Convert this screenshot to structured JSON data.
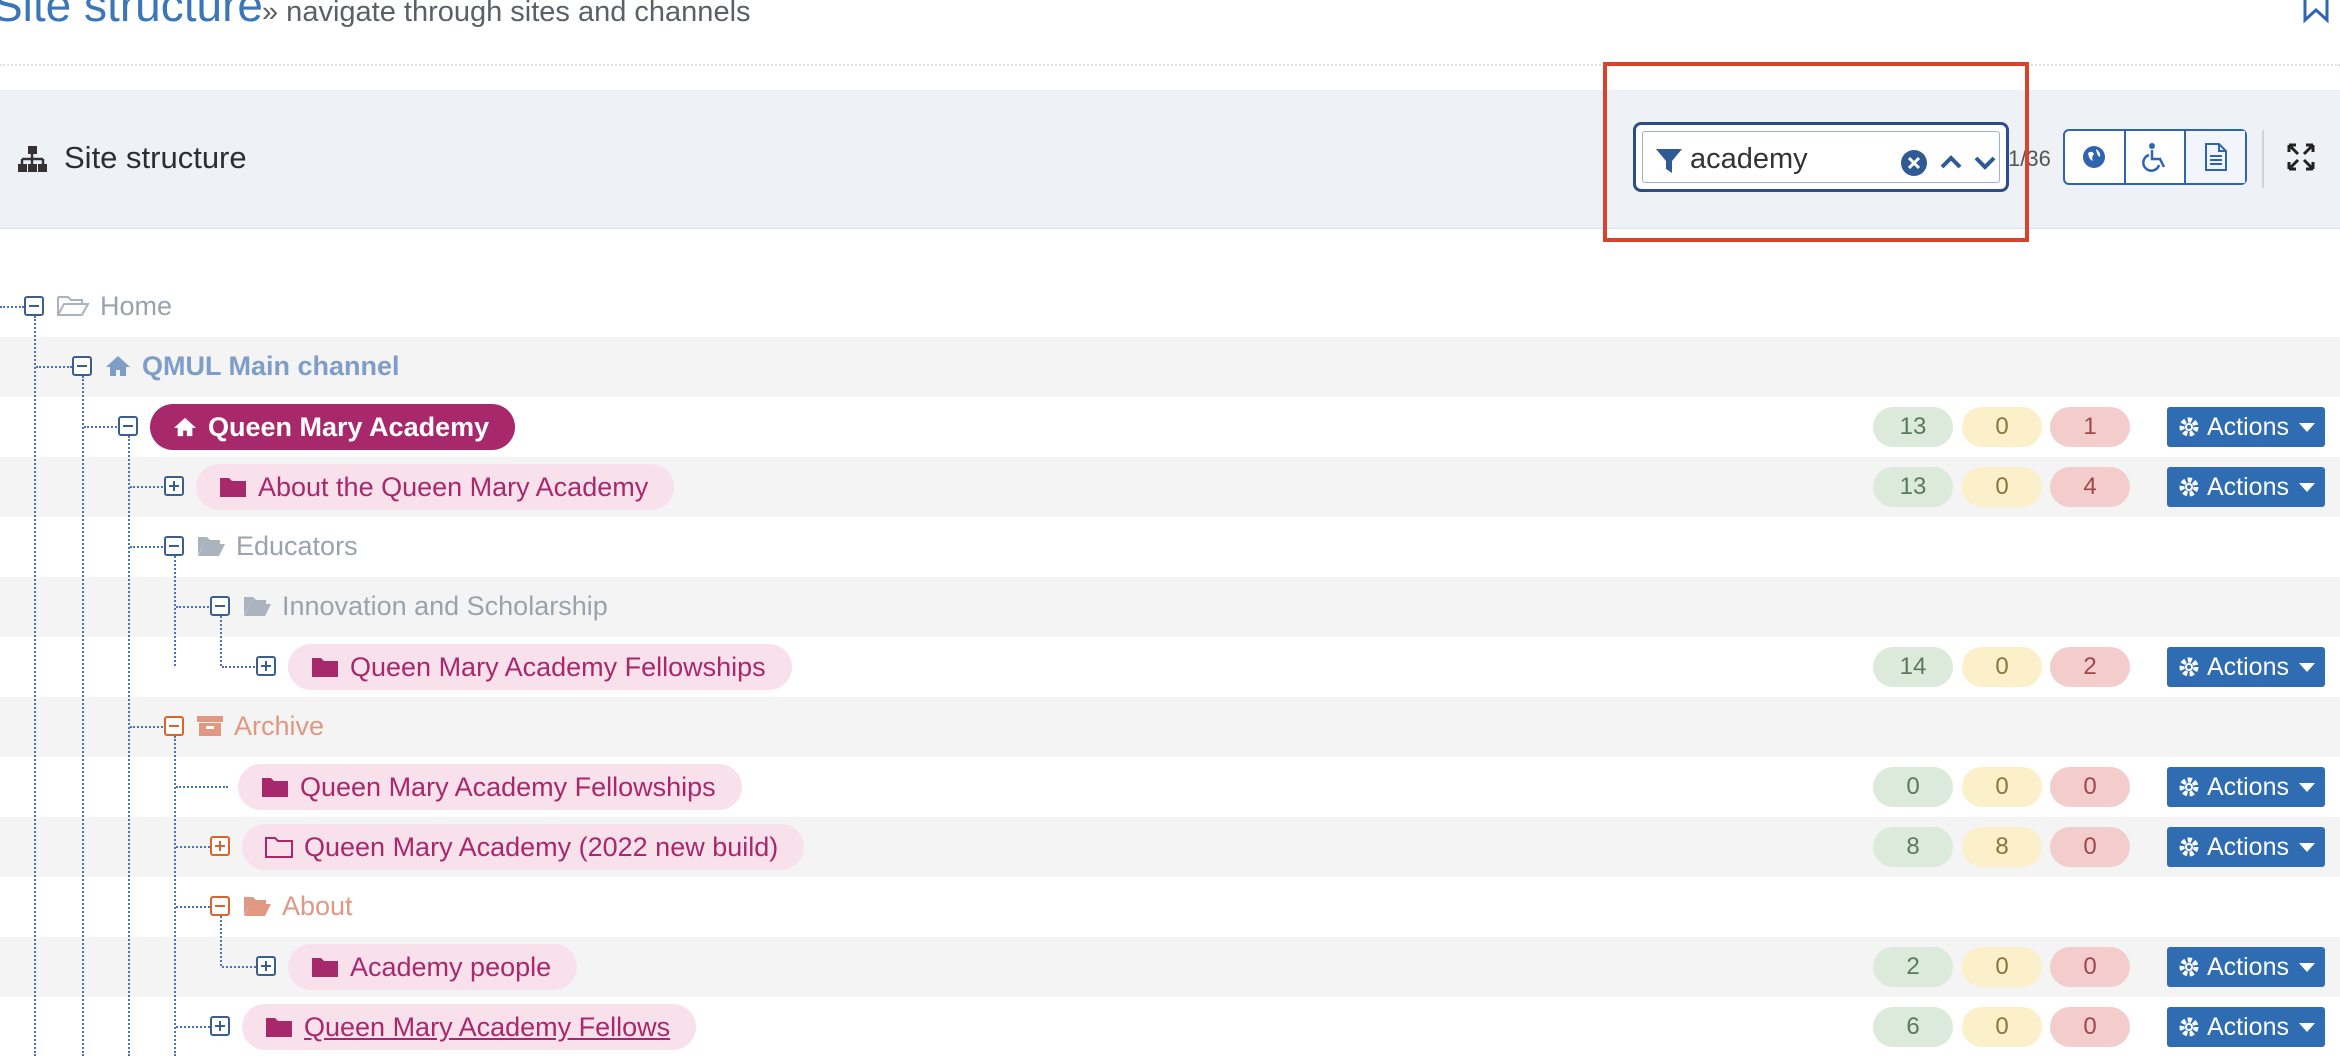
{
  "header": {
    "title": "Site structure",
    "subtitle": "» navigate through sites and channels"
  },
  "panel": {
    "title": "Site structure",
    "filter_value": "academy",
    "counter": "1/36"
  },
  "colors": {
    "brand_primary": "#2f6cb2",
    "node_selected": "#a8286c",
    "node_pill": "#f9e1ec",
    "highlight": "#d9432c"
  },
  "tree": [
    {
      "label": "Home",
      "icon": "folder-open-outline-icon",
      "toggle": "minus",
      "style": "plain"
    },
    {
      "label": "QMUL Main channel",
      "icon": "home-icon",
      "toggle": "minus",
      "style": "channel"
    },
    {
      "label": "Queen Mary Academy",
      "icon": "home-icon",
      "toggle": "minus",
      "style": "selected",
      "counts": [
        13,
        0,
        1
      ]
    },
    {
      "label": "About the Queen Mary Academy",
      "icon": "folder-icon",
      "toggle": "plus",
      "style": "pill",
      "counts": [
        13,
        0,
        4
      ]
    },
    {
      "label": "Educators",
      "icon": "folder-open-icon",
      "toggle": "minus",
      "style": "plain"
    },
    {
      "label": "Innovation and Scholarship",
      "icon": "folder-open-icon",
      "toggle": "minus",
      "style": "plain"
    },
    {
      "label": "Queen Mary Academy Fellowships",
      "icon": "folder-icon",
      "toggle": "plus",
      "style": "pill",
      "counts": [
        14,
        0,
        2
      ]
    },
    {
      "label": "Archive",
      "icon": "archive-icon",
      "toggle": "minus-orange",
      "style": "orange"
    },
    {
      "label": "Queen Mary Academy Fellowships",
      "icon": "folder-icon",
      "toggle": "none",
      "style": "pill",
      "counts": [
        0,
        0,
        0
      ]
    },
    {
      "label": "Queen Mary Academy (2022 new build)",
      "icon": "folder-outline-icon",
      "toggle": "plus-orange",
      "style": "pill",
      "counts": [
        8,
        8,
        0
      ]
    },
    {
      "label": "About",
      "icon": "folder-open-icon",
      "toggle": "minus-orange",
      "style": "orange"
    },
    {
      "label": "Academy people",
      "icon": "folder-icon",
      "toggle": "plus",
      "style": "pill",
      "counts": [
        2,
        0,
        0
      ]
    },
    {
      "label": "Queen Mary Academy Fellows",
      "icon": "folder-icon",
      "toggle": "plus",
      "style": "pill-underline",
      "counts": [
        6,
        0,
        0
      ]
    }
  ],
  "actions_label": "Actions"
}
